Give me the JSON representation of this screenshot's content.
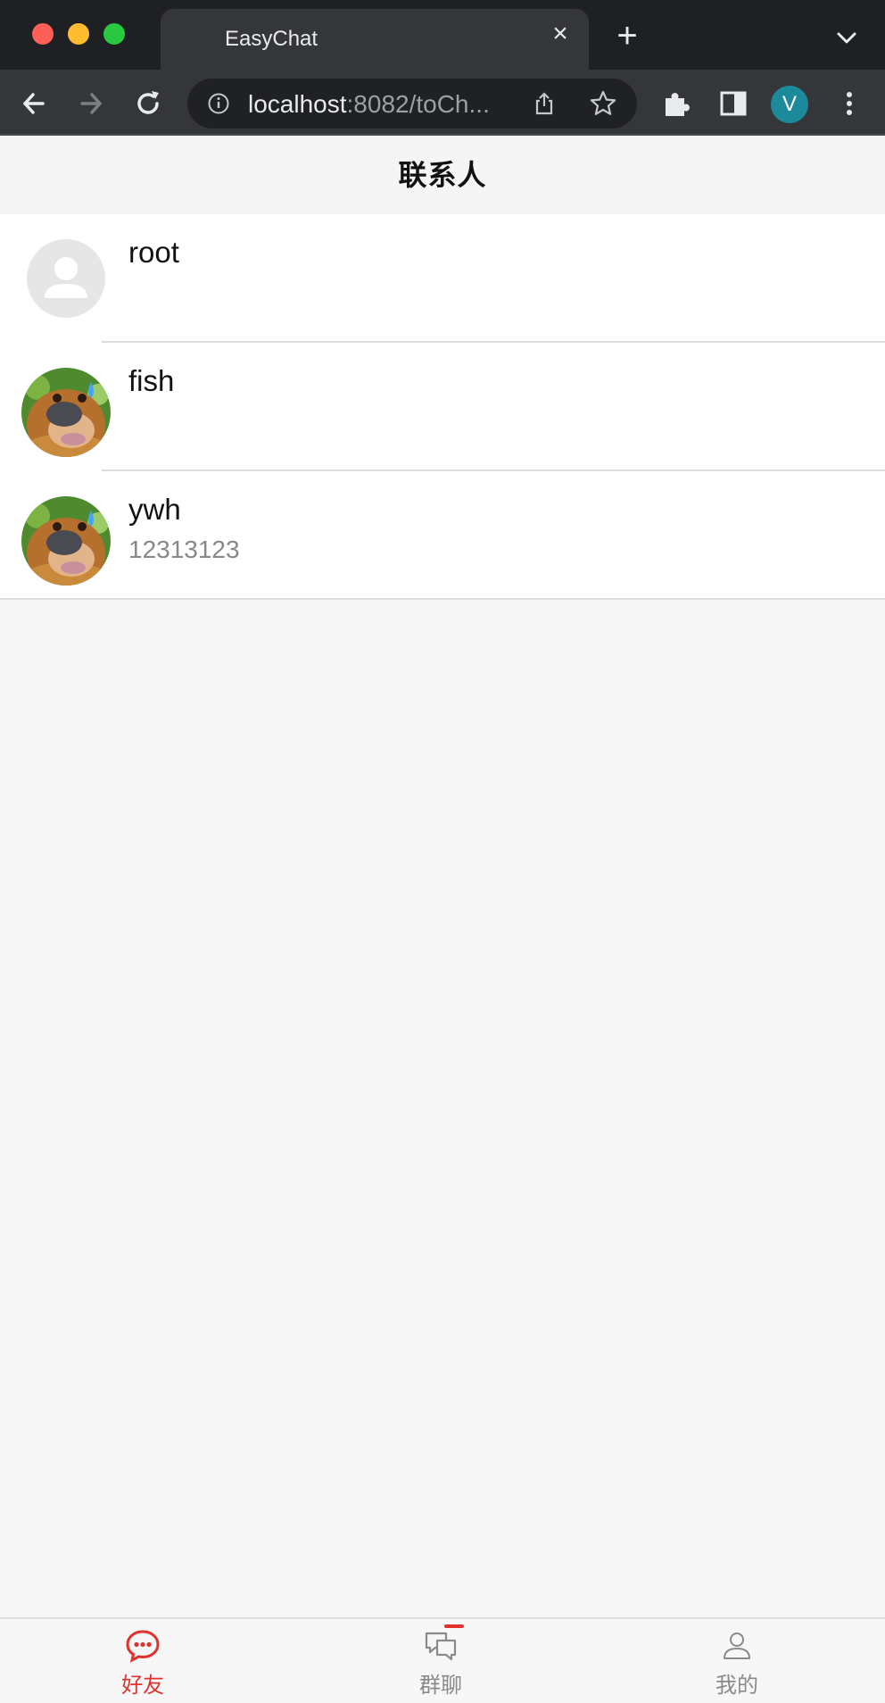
{
  "browser": {
    "tab_title": "EasyChat",
    "tab_close_icon": "close-icon",
    "new_tab_icon": "plus-icon",
    "url_host": "localhost",
    "url_rest": ":8082/toCh...",
    "profile_initial": "V",
    "profile_color": "#1d8a9c"
  },
  "header": {
    "title": "联系人"
  },
  "contacts": [
    {
      "name": "root",
      "subtitle": "",
      "avatar": "default-avatar-icon"
    },
    {
      "name": "fish",
      "subtitle": "",
      "avatar": "bear-avatar"
    },
    {
      "name": "ywh",
      "subtitle": "12313123",
      "avatar": "bear-avatar"
    }
  ],
  "bottom_nav": {
    "items": [
      {
        "label": "好友",
        "icon": "chat-bubble-icon",
        "active": true
      },
      {
        "label": "群聊",
        "icon": "group-chat-icon",
        "active": false
      },
      {
        "label": "我的",
        "icon": "person-icon",
        "active": false
      }
    ],
    "active_color": "#e0332e",
    "inactive_color": "#8a8a8a"
  }
}
